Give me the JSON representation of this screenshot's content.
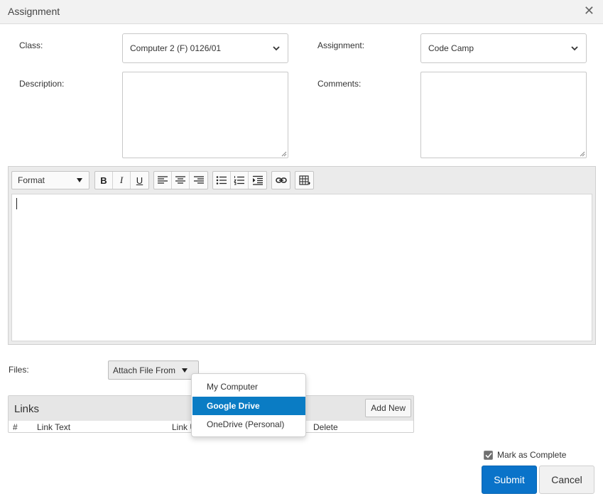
{
  "dialog": {
    "title": "Assignment",
    "close_icon": "close-icon",
    "close_glyph": "✕"
  },
  "form": {
    "class_label": "Class:",
    "class_value": "Computer 2 (F) 0126/01",
    "assignment_label": "Assignment:",
    "assignment_value": "Code Camp",
    "description_label": "Description:",
    "comments_label": "Comments:"
  },
  "editor": {
    "format_label": "Format",
    "toolbar": {
      "bold": "B",
      "italic": "I",
      "underline": "U",
      "icons": [
        "align-left-icon",
        "align-center-icon",
        "align-right-icon",
        "bulleted-list-icon",
        "numbered-list-icon",
        "indent-icon",
        "link-icon",
        "table-icon"
      ]
    }
  },
  "files": {
    "label": "Files:",
    "attach_label": "Attach File From",
    "menu": [
      {
        "label": "My Computer",
        "active": false
      },
      {
        "label": "Google Drive",
        "active": true
      },
      {
        "label": "OneDrive (Personal)",
        "active": false
      }
    ]
  },
  "links": {
    "title": "Links",
    "add_new": "Add New",
    "columns": [
      "#",
      "Link Text",
      "Link U",
      "Delete"
    ]
  },
  "footer": {
    "mark_complete": "Mark as Complete",
    "mark_complete_checked": true,
    "submit": "Submit",
    "cancel": "Cancel"
  },
  "colors": {
    "primary": "#0a73c9",
    "menu_highlight": "#0a7cc4"
  }
}
